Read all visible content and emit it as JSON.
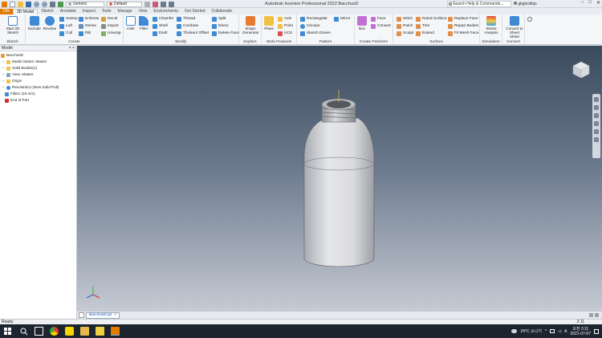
{
  "titlebar": {
    "app_title": "Autodesk Inventor Professional 2022   BacchusD",
    "material": "Generic",
    "appearance": "Default",
    "search_placeholder": "Search Help & Commands...",
    "user": "gkgkcldnjs"
  },
  "tabs": [
    "File",
    "3D Model",
    "Sketch",
    "Annotate",
    "Inspect",
    "Tools",
    "Manage",
    "View",
    "Environments",
    "Get Started",
    "Collaborate"
  ],
  "ribbon": {
    "sketch": {
      "label": "Sketch",
      "start": "Start 2D Sketch"
    },
    "create": {
      "label": "Create",
      "extrude": "Extrude",
      "revolve": "Revolve",
      "sweep": "Sweep",
      "loft": "Loft",
      "coil": "Coil",
      "emboss": "Emboss",
      "derive": "Derive",
      "rib": "Rib",
      "decal": "Decal",
      "import": "Import",
      "unwrap": "Unwrap"
    },
    "modify": {
      "label": "Modify",
      "hole": "Hole",
      "fillet": "Fillet",
      "chamfer": "Chamfer",
      "shell": "Shell",
      "draft": "Draft",
      "thread": "Thread",
      "combine": "Combine",
      "thicken": "Thicken/ Offset",
      "split": "Split",
      "direct": "Direct",
      "delete_face": "Delete Face"
    },
    "explore": {
      "label": "Explore",
      "shape_generator": "Shape Generator"
    },
    "work_features": {
      "label": "Work Features",
      "plane": "Plane",
      "axis": "Axis",
      "point": "Point",
      "ucs": "UCS"
    },
    "pattern": {
      "label": "Pattern",
      "rectangular": "Rectangular",
      "circular": "Circular",
      "sketch_driven": "Sketch Driven",
      "mirror": "Mirror"
    },
    "freeform": {
      "label": "Create Freeform",
      "box": "Box",
      "face": "Face",
      "convert": "Convert"
    },
    "surface": {
      "label": "Surface",
      "stitch": "Stitch",
      "patch": "Patch",
      "sculpt": "Sculpt",
      "ruled_surface": "Ruled Surface",
      "trim": "Trim",
      "extend": "Extend",
      "replace_face": "Replace Face",
      "repair_bodies": "Repair Bodies",
      "fit_mesh_face": "Fit Mesh Face"
    },
    "simulation": {
      "label": "Simulation",
      "stress_analysis": "Stress Analysis"
    },
    "convert": {
      "label": "Convert",
      "convert_sheet": "Convert to Sheet Metal"
    }
  },
  "browser": {
    "title": "Model",
    "nodes": [
      {
        "text": "BacchusD",
        "level": 0
      },
      {
        "text": "Model States: Master",
        "level": 1
      },
      {
        "text": "Solid Bodies(1)",
        "level": 1
      },
      {
        "text": "View: Master",
        "level": 1
      },
      {
        "text": "Origin",
        "level": 1
      },
      {
        "text": "Revolution1 (New Solid Pull)",
        "level": 1
      },
      {
        "text": "Fillet1 (15 mm)",
        "level": 1
      },
      {
        "text": "End of Part",
        "level": 1
      }
    ]
  },
  "document_tab": "BacchusD.ipt",
  "status": {
    "text": "Ready",
    "count": "3   11"
  },
  "taskbar": {
    "weather": "24°C  소나기",
    "time": "오전 3:11",
    "date": "2021-07-07",
    "lang": "A"
  },
  "colors": {
    "file_tab": "#e07b00",
    "accent": "#1a58b0",
    "taskbar": "#1c2430"
  }
}
